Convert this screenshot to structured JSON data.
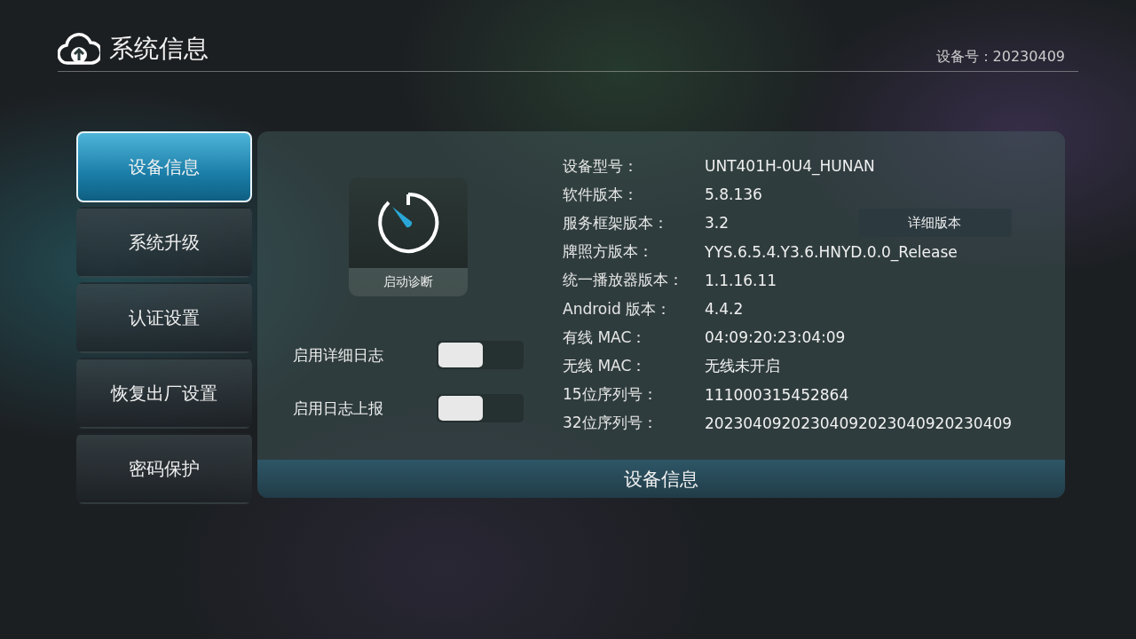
{
  "header": {
    "title": "系统信息",
    "device_number": "设备号：20230409"
  },
  "sidebar": {
    "items": [
      {
        "label": "设备信息",
        "selected": true
      },
      {
        "label": "系统升级",
        "selected": false
      },
      {
        "label": "认证设置",
        "selected": false
      },
      {
        "label": "恢复出厂设置",
        "selected": false
      },
      {
        "label": "密码保护",
        "selected": false
      }
    ]
  },
  "diagnostics_button": {
    "label": "启动诊断"
  },
  "toggles": [
    {
      "label": "启用详细日志",
      "on": false
    },
    {
      "label": "启用日志上报",
      "on": false
    }
  ],
  "info": [
    {
      "label": "设备型号：",
      "value": "UNT401H-0U4_HUNAN"
    },
    {
      "label": "软件版本：",
      "value": "5.8.136"
    },
    {
      "label": "服务框架版本：",
      "value": "3.2",
      "button": "详细版本"
    },
    {
      "label": "牌照方版本：",
      "value": "YYS.6.5.4.Y3.6.HNYD.0.0_Release"
    },
    {
      "label": "统一播放器版本：",
      "value": "1.1.16.11"
    },
    {
      "label": "Android 版本：",
      "value": "4.4.2"
    },
    {
      "label": "有线 MAC：",
      "value": "04:09:20:23:04:09"
    },
    {
      "label": "无线 MAC：",
      "value": "无线未开启"
    },
    {
      "label": "15位序列号：",
      "value": "111000315452864"
    },
    {
      "label": "32位序列号：",
      "value": "20230409202304092023040920230409"
    }
  ],
  "footer": {
    "title": "设备信息"
  }
}
